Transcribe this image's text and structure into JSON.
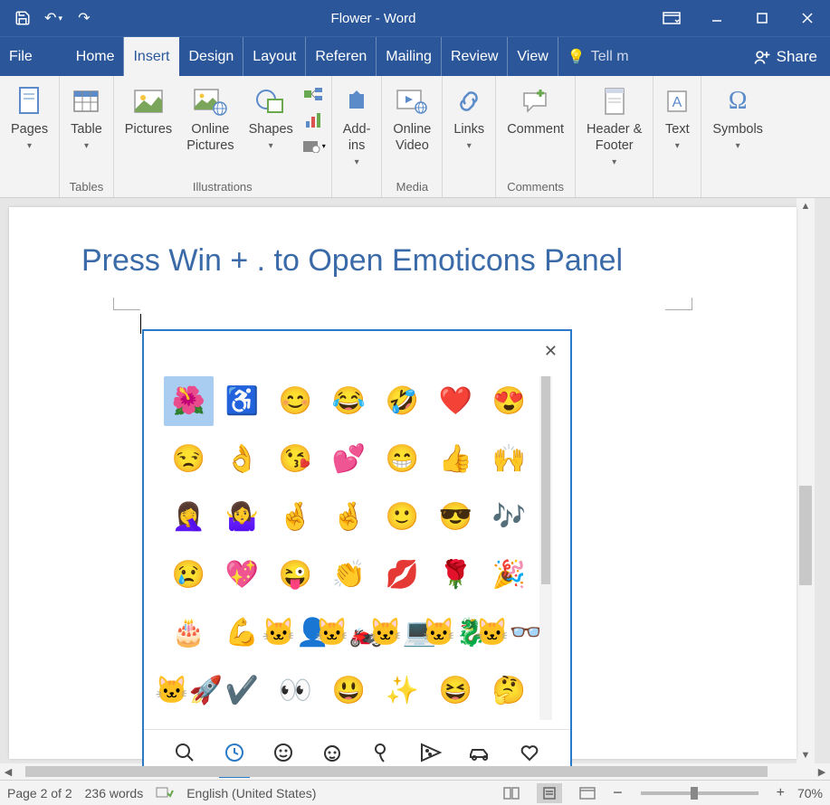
{
  "app": {
    "title": "Flower - Word"
  },
  "menu": {
    "file": "File",
    "tabs": [
      "Home",
      "Insert",
      "Design",
      "Layout",
      "Referen",
      "Mailing",
      "Review",
      "View"
    ],
    "active_index": 1,
    "tellme": "Tell m",
    "share": "Share"
  },
  "ribbon": {
    "groups": {
      "pages": {
        "label": "",
        "buttons": [
          {
            "label": "Pages",
            "dd": true
          }
        ]
      },
      "tables": {
        "label": "Tables",
        "buttons": [
          {
            "label": "Table",
            "dd": true
          }
        ]
      },
      "illustrations": {
        "label": "Illustrations",
        "buttons": [
          {
            "label": "Pictures"
          },
          {
            "label": "Online\nPictures"
          },
          {
            "label": "Shapes",
            "dd": true
          }
        ]
      },
      "addins": {
        "label": "",
        "buttons": [
          {
            "label": "Add-\nins",
            "dd": true
          }
        ]
      },
      "media": {
        "label": "Media",
        "buttons": [
          {
            "label": "Online\nVideo"
          }
        ]
      },
      "links": {
        "label": "",
        "buttons": [
          {
            "label": "Links",
            "dd": true
          }
        ]
      },
      "comments": {
        "label": "Comments",
        "buttons": [
          {
            "label": "Comment"
          }
        ]
      },
      "headerfooter": {
        "label": "",
        "buttons": [
          {
            "label": "Header &\nFooter",
            "dd": true
          }
        ]
      },
      "text": {
        "label": "",
        "buttons": [
          {
            "label": "Text",
            "dd": true
          }
        ]
      },
      "symbols": {
        "label": "",
        "buttons": [
          {
            "label": "Symbols",
            "dd": true
          }
        ]
      }
    }
  },
  "document": {
    "heading": "Press Win + . to Open Emoticons Panel"
  },
  "emoji": {
    "grid": [
      [
        "🌺",
        "♿",
        "😊",
        "😂",
        "🤣",
        "❤️",
        "😍"
      ],
      [
        "😒",
        "👌",
        "😘",
        "💕",
        "😁",
        "👍",
        "🙌"
      ],
      [
        "🤦‍♀️",
        "🤷‍♀️",
        "🤞",
        "🤞",
        "🙂",
        "😎",
        "🎶"
      ],
      [
        "😢",
        "💖",
        "😜",
        "👏",
        "💋",
        "🌹",
        "🎉"
      ],
      [
        "🎂",
        "💪",
        "🐱‍👤",
        "🐱‍🏍",
        "🐱‍💻",
        "🐱‍🐉",
        "🐱‍👓"
      ],
      [
        "🐱‍🚀",
        "✔️",
        "👀",
        "😃",
        "✨",
        "😆",
        "🤔"
      ]
    ],
    "selected_row": 0,
    "selected_col": 0,
    "tabs": [
      "search",
      "recent",
      "smileys",
      "people",
      "places",
      "food",
      "transport",
      "heart"
    ]
  },
  "status": {
    "page": "Page 2 of 2",
    "words": "236 words",
    "lang": "English (United States)",
    "zoom_pct": "70%"
  }
}
